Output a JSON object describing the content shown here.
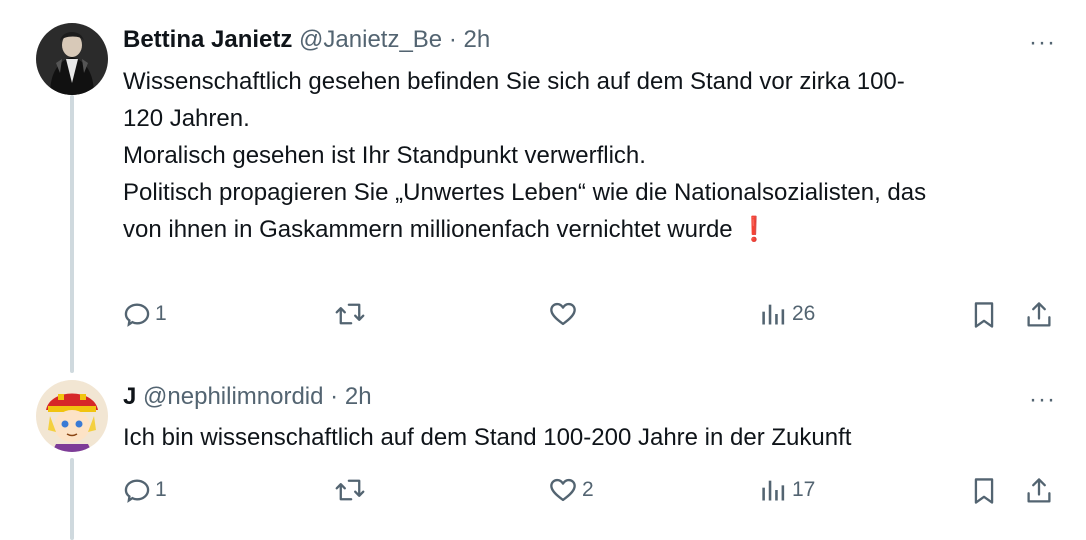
{
  "tweets": [
    {
      "name": "Bettina Janietz",
      "handle": "@Janietz_Be",
      "separator": "·",
      "time": "2h",
      "lines": [
        "Wissenschaftlich gesehen befinden Sie sich auf dem Stand vor zirka 100-",
        "120 Jahren.",
        "Moralisch gesehen ist Ihr Standpunkt verwerflich.",
        "",
        "Politisch propagieren Sie „Unwertes Leben“ wie die Nationalsozialisten, das",
        "von ihnen in Gaskammern millionenfach vernichtet wurde"
      ],
      "emoji": "❗",
      "replies": "1",
      "retweets": "",
      "likes": "",
      "views": "26"
    },
    {
      "name": "J",
      "handle": "@nephilimnordid",
      "separator": "·",
      "time": "2h",
      "lines": [
        "Ich bin wissenschaftlich auf dem Stand 100-200 Jahre in der Zukunft"
      ],
      "replies": "1",
      "retweets": "",
      "likes": "2",
      "views": "17"
    }
  ],
  "more_label": "···",
  "colors": {
    "text": "#0f1419",
    "secondary": "#536471",
    "thread_line": "#cfd9de",
    "emoji_red": "#e0245e"
  }
}
